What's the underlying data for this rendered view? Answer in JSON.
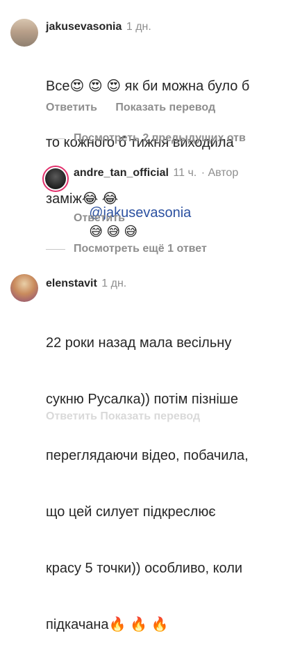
{
  "comments": [
    {
      "username": "jakusevasonia",
      "time": "1 дн.",
      "lines": [
        "Все😍 😍 😍 як би можна було б",
        "то кожного б тижня виходила",
        "заміж😂 😂"
      ],
      "actions": [
        "Ответить",
        "Показать перевод"
      ]
    }
  ],
  "replies_toggle_1": "Посмотреть 2 предыдущих отв",
  "reply": {
    "username": "andre_tan_official",
    "time": "11 ч.",
    "author_tag": "· Автор",
    "mention": "@jakusevasonia",
    "emojis": "😅 😅 😅",
    "action": "Ответить"
  },
  "replies_toggle_2": "Посмотреть ещё 1 ответ",
  "comment2": {
    "username": "elenstavit",
    "time": "1 дн.",
    "lines": [
      "22 роки назад мала весільну",
      "сукню Русалка)) потім пізніше",
      "переглядаючи відео, побачила,",
      "що цей силует підкреслює",
      "красу 5 точки)) особливо, коли",
      "підкачана🔥 🔥 🔥"
    ],
    "faded_actions": "Ответить   Показать перевод"
  },
  "colors": {
    "text": "#262626",
    "muted": "#8e8e8e",
    "mention": "#2b50a0",
    "story_ring": "#e1306c"
  }
}
